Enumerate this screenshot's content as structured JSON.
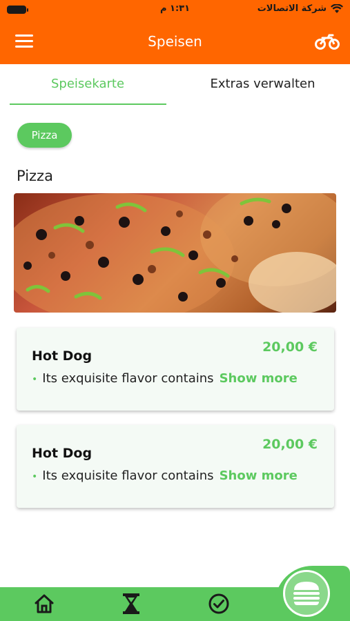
{
  "status_bar": {
    "time": "١:٣١ م",
    "carrier": "شركة الاتصالات"
  },
  "header": {
    "title": "Speisen"
  },
  "tabs": [
    {
      "label": "Speisekarte",
      "active": true
    },
    {
      "label": "Extras verwalten",
      "active": false
    }
  ],
  "category_chip": {
    "label": "Pizza"
  },
  "section": {
    "title": "Pizza"
  },
  "items": [
    {
      "name": "Hot Dog",
      "price": "20,00 €",
      "description": "Its exquisite flavor contains",
      "show_more": "Show more"
    },
    {
      "name": "Hot Dog",
      "price": "20,00 €",
      "description": "Its exquisite flavor contains",
      "show_more": "Show more"
    }
  ],
  "bottom_nav": {
    "items": [
      "home-icon",
      "hourglass-icon",
      "check-circle-icon"
    ],
    "fab": "burger-icon"
  },
  "colors": {
    "header_orange": "#ff6600",
    "accent_green": "#5cc95f"
  }
}
